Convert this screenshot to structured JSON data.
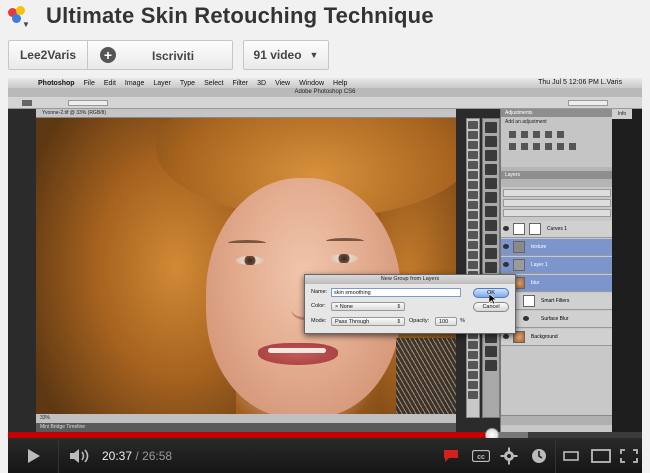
{
  "header": {
    "title": "Ultimate Skin Retouching Technique",
    "user_label": "Lee2Varis",
    "subscribe_label": "Iscriviti",
    "videos_label": "91 video"
  },
  "photoshop": {
    "menu": [
      "Photoshop",
      "File",
      "Edit",
      "Image",
      "Layer",
      "Type",
      "Select",
      "Filter",
      "3D",
      "View",
      "Window",
      "Help"
    ],
    "clock": "Thu Jul 5  12:06 PM   L.Varis",
    "app_title": "Adobe Photoshop CS6",
    "doc_tab": "Yvonne-2.tif @ 33% (RGB/8)",
    "panel_tabs": {
      "adjustments": "Adjustments",
      "add_adjustment": "Add an adjustment",
      "layers": "Layers",
      "info": "Info"
    },
    "layers": [
      {
        "name": "Curves 1",
        "selected": false
      },
      {
        "name": "texture",
        "selected": true
      },
      {
        "name": "Layer 1",
        "selected": true
      },
      {
        "name": "blur",
        "selected": true
      },
      {
        "name": "Smart Filters",
        "selected": false
      },
      {
        "name": "Surface Blur",
        "selected": false
      },
      {
        "name": "Background",
        "selected": false
      }
    ],
    "status_zoom": "33%",
    "mini_bridge": "Mini Bridge   Timeline"
  },
  "dialog": {
    "title": "New Group from Layers",
    "name_label": "Name:",
    "name_value": "skin smoothing",
    "color_label": "Color:",
    "color_value": "None",
    "mode_label": "Mode:",
    "mode_value": "Pass Through",
    "opacity_label": "Opacity:",
    "opacity_value": "100",
    "opacity_unit": "%",
    "ok_label": "OK",
    "cancel_label": "Cancel"
  },
  "player": {
    "current_time": "20:37",
    "time_separator": "/",
    "duration": "26:58",
    "progress_fraction": 0.763,
    "buffered_fraction": 0.82
  },
  "colors": {
    "accent_red": "#c40000",
    "layer_selected": "#7c95cc"
  }
}
